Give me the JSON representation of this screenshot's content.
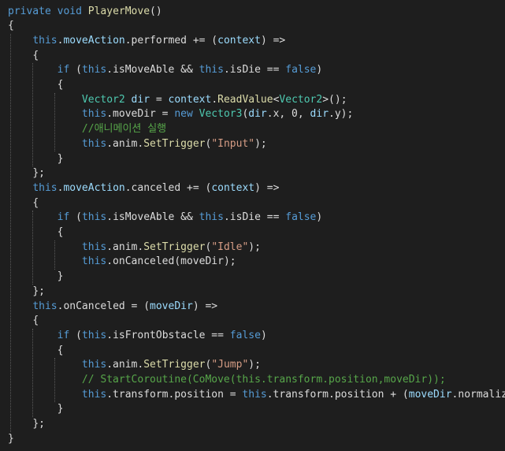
{
  "codeLines": [
    {
      "indent": 0,
      "tokens": [
        {
          "t": "private",
          "c": "kw"
        },
        {
          "t": " ",
          "c": "pl"
        },
        {
          "t": "void",
          "c": "kw"
        },
        {
          "t": " ",
          "c": "pl"
        },
        {
          "t": "PlayerMove",
          "c": "me"
        },
        {
          "t": "()",
          "c": "pl"
        }
      ]
    },
    {
      "indent": 0,
      "tokens": [
        {
          "t": "{",
          "c": "pl"
        }
      ]
    },
    {
      "indent": 1,
      "tokens": [
        {
          "t": "this",
          "c": "kw"
        },
        {
          "t": ".",
          "c": "pl"
        },
        {
          "t": "moveAction",
          "c": "pa"
        },
        {
          "t": ".performed += (",
          "c": "pl"
        },
        {
          "t": "context",
          "c": "pa"
        },
        {
          "t": ") =>",
          "c": "pl"
        }
      ]
    },
    {
      "indent": 1,
      "tokens": [
        {
          "t": "{",
          "c": "pl"
        }
      ]
    },
    {
      "indent": 2,
      "tokens": [
        {
          "t": "if",
          "c": "kw"
        },
        {
          "t": " (",
          "c": "pl"
        },
        {
          "t": "this",
          "c": "kw"
        },
        {
          "t": ".isMoveAble && ",
          "c": "pl"
        },
        {
          "t": "this",
          "c": "kw"
        },
        {
          "t": ".isDie == ",
          "c": "pl"
        },
        {
          "t": "false",
          "c": "kw"
        },
        {
          "t": ")",
          "c": "pl"
        }
      ]
    },
    {
      "indent": 2,
      "tokens": [
        {
          "t": "{",
          "c": "pl"
        }
      ]
    },
    {
      "indent": 3,
      "tokens": [
        {
          "t": "Vector2",
          "c": "ty"
        },
        {
          "t": " ",
          "c": "pl"
        },
        {
          "t": "dir",
          "c": "pa"
        },
        {
          "t": " = ",
          "c": "pl"
        },
        {
          "t": "context",
          "c": "pa"
        },
        {
          "t": ".",
          "c": "pl"
        },
        {
          "t": "ReadValue",
          "c": "me"
        },
        {
          "t": "<",
          "c": "pl"
        },
        {
          "t": "Vector2",
          "c": "ty"
        },
        {
          "t": ">();",
          "c": "pl"
        }
      ]
    },
    {
      "indent": 3,
      "tokens": [
        {
          "t": "this",
          "c": "kw"
        },
        {
          "t": ".moveDir = ",
          "c": "pl"
        },
        {
          "t": "new",
          "c": "kw"
        },
        {
          "t": " ",
          "c": "pl"
        },
        {
          "t": "Vector3",
          "c": "ty"
        },
        {
          "t": "(",
          "c": "pl"
        },
        {
          "t": "dir",
          "c": "pa"
        },
        {
          "t": ".x, 0, ",
          "c": "pl"
        },
        {
          "t": "dir",
          "c": "pa"
        },
        {
          "t": ".y);",
          "c": "pl"
        }
      ]
    },
    {
      "indent": 3,
      "tokens": [
        {
          "t": "//애니메이션 실행",
          "c": "cm"
        }
      ]
    },
    {
      "indent": 3,
      "tokens": [
        {
          "t": "this",
          "c": "kw"
        },
        {
          "t": ".anim.",
          "c": "pl"
        },
        {
          "t": "SetTrigger",
          "c": "me"
        },
        {
          "t": "(",
          "c": "pl"
        },
        {
          "t": "\"Input\"",
          "c": "st"
        },
        {
          "t": ");",
          "c": "pl"
        }
      ]
    },
    {
      "indent": 2,
      "tokens": [
        {
          "t": "}",
          "c": "pl"
        }
      ]
    },
    {
      "indent": 1,
      "tokens": [
        {
          "t": "};",
          "c": "pl"
        }
      ]
    },
    {
      "indent": 1,
      "tokens": [
        {
          "t": "this",
          "c": "kw"
        },
        {
          "t": ".",
          "c": "pl"
        },
        {
          "t": "moveAction",
          "c": "pa"
        },
        {
          "t": ".canceled += (",
          "c": "pl"
        },
        {
          "t": "context",
          "c": "pa"
        },
        {
          "t": ") =>",
          "c": "pl"
        }
      ]
    },
    {
      "indent": 1,
      "tokens": [
        {
          "t": "{",
          "c": "pl"
        }
      ]
    },
    {
      "indent": 2,
      "tokens": [
        {
          "t": "if",
          "c": "kw"
        },
        {
          "t": " (",
          "c": "pl"
        },
        {
          "t": "this",
          "c": "kw"
        },
        {
          "t": ".isMoveAble && ",
          "c": "pl"
        },
        {
          "t": "this",
          "c": "kw"
        },
        {
          "t": ".isDie == ",
          "c": "pl"
        },
        {
          "t": "false",
          "c": "kw"
        },
        {
          "t": ")",
          "c": "pl"
        }
      ]
    },
    {
      "indent": 2,
      "tokens": [
        {
          "t": "{",
          "c": "pl"
        }
      ]
    },
    {
      "indent": 3,
      "tokens": [
        {
          "t": "this",
          "c": "kw"
        },
        {
          "t": ".anim.",
          "c": "pl"
        },
        {
          "t": "SetTrigger",
          "c": "me"
        },
        {
          "t": "(",
          "c": "pl"
        },
        {
          "t": "\"Idle\"",
          "c": "st"
        },
        {
          "t": ");",
          "c": "pl"
        }
      ]
    },
    {
      "indent": 3,
      "tokens": [
        {
          "t": "this",
          "c": "kw"
        },
        {
          "t": ".onCanceled(moveDir);",
          "c": "pl"
        }
      ]
    },
    {
      "indent": 2,
      "tokens": [
        {
          "t": "}",
          "c": "pl"
        }
      ]
    },
    {
      "indent": 1,
      "tokens": [
        {
          "t": "};",
          "c": "pl"
        }
      ]
    },
    {
      "indent": 1,
      "tokens": [
        {
          "t": "this",
          "c": "kw"
        },
        {
          "t": ".onCanceled = (",
          "c": "pl"
        },
        {
          "t": "moveDir",
          "c": "pa"
        },
        {
          "t": ") =>",
          "c": "pl"
        }
      ]
    },
    {
      "indent": 1,
      "tokens": [
        {
          "t": "{",
          "c": "pl"
        }
      ]
    },
    {
      "indent": 2,
      "tokens": [
        {
          "t": "if",
          "c": "kw"
        },
        {
          "t": " (",
          "c": "pl"
        },
        {
          "t": "this",
          "c": "kw"
        },
        {
          "t": ".isFrontObstacle == ",
          "c": "pl"
        },
        {
          "t": "false",
          "c": "kw"
        },
        {
          "t": ")",
          "c": "pl"
        }
      ]
    },
    {
      "indent": 2,
      "tokens": [
        {
          "t": "{",
          "c": "pl"
        }
      ]
    },
    {
      "indent": 3,
      "tokens": [
        {
          "t": "this",
          "c": "kw"
        },
        {
          "t": ".anim.",
          "c": "pl"
        },
        {
          "t": "SetTrigger",
          "c": "me"
        },
        {
          "t": "(",
          "c": "pl"
        },
        {
          "t": "\"Jump\"",
          "c": "st"
        },
        {
          "t": ");",
          "c": "pl"
        }
      ]
    },
    {
      "indent": 3,
      "tokens": [
        {
          "t": "// StartCoroutine(CoMove(this.transform.position,moveDir));",
          "c": "cm"
        }
      ]
    },
    {
      "indent": 3,
      "tokens": [
        {
          "t": "this",
          "c": "kw"
        },
        {
          "t": ".transform.position = ",
          "c": "pl"
        },
        {
          "t": "this",
          "c": "kw"
        },
        {
          "t": ".transform.position + (",
          "c": "pl"
        },
        {
          "t": "moveDir",
          "c": "pa"
        },
        {
          "t": ".normalized);",
          "c": "pl"
        }
      ]
    },
    {
      "indent": 2,
      "tokens": [
        {
          "t": "}",
          "c": "pl"
        }
      ]
    },
    {
      "indent": 1,
      "tokens": [
        {
          "t": "};",
          "c": "pl"
        }
      ]
    },
    {
      "indent": 0,
      "tokens": [
        {
          "t": "}",
          "c": "pl"
        }
      ]
    }
  ],
  "colors": {
    "background": "#1e1e1e",
    "keyword": "#569cd6",
    "type": "#4ec9b0",
    "method": "#dcdcaa",
    "parameter": "#9cdcfe",
    "string": "#d69d85",
    "comment": "#57a64a",
    "plain": "#dcdcdc"
  }
}
